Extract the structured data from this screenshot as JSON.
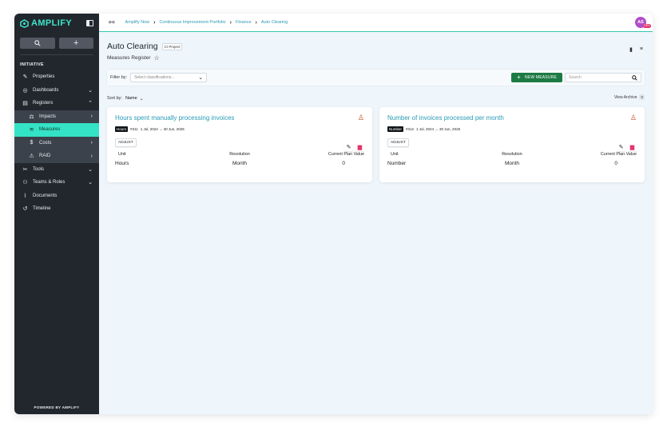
{
  "sidebar": {
    "logo_text": "AMPLIFY",
    "section_label": "INITIATIVE",
    "items": [
      {
        "label": "Properties"
      },
      {
        "label": "Dashboards"
      },
      {
        "label": "Registers"
      },
      {
        "label": "Impacts"
      },
      {
        "label": "Measures"
      },
      {
        "label": "Costs"
      },
      {
        "label": "RAID"
      },
      {
        "label": "Tools"
      },
      {
        "label": "Teams & Roles"
      },
      {
        "label": "Documents"
      },
      {
        "label": "Timeline"
      }
    ],
    "footer": "POWERED BY AMPLIFY",
    "accent_color": "#34e3c5"
  },
  "breadcrumb": {
    "items": [
      "Amplify Now",
      "Continuous Improvement Portfolio",
      "Finance",
      "Auto Clearing"
    ]
  },
  "user": {
    "initials": "AS",
    "badge": "DEV"
  },
  "page": {
    "title": "Auto Clearing",
    "tag": "CI Project",
    "subtitle": "Measures Register"
  },
  "filter": {
    "label": "Filter by:",
    "placeholder": "Select classifications...",
    "new_button": "NEW MEASURE",
    "search_placeholder": "Search"
  },
  "sort": {
    "label": "Sort by:",
    "value": "Name",
    "view_archive": "View Archive",
    "archive_count": "0"
  },
  "cards": [
    {
      "title": "Hours spent manually processing invoices",
      "unit_badge": "Hours",
      "id": "#311",
      "dates": "1 Jul, 2024 → 30 Jun, 2025",
      "adjust": "ADJUST",
      "col_unit": "Unit",
      "col_resolution": "Resolution",
      "col_plan": "Current Plan Value",
      "unit": "Hours",
      "resolution": "Month",
      "plan_value": "0"
    },
    {
      "title": "Number of invoices processed per month",
      "unit_badge": "Number",
      "id": "#312",
      "dates": "1 Jul, 2024 → 30 Jun, 2025",
      "adjust": "ADJUST",
      "col_unit": "Unit",
      "col_resolution": "Resolution",
      "col_plan": "Current Plan Value",
      "unit": "Number",
      "resolution": "Month",
      "plan_value": "0"
    }
  ]
}
